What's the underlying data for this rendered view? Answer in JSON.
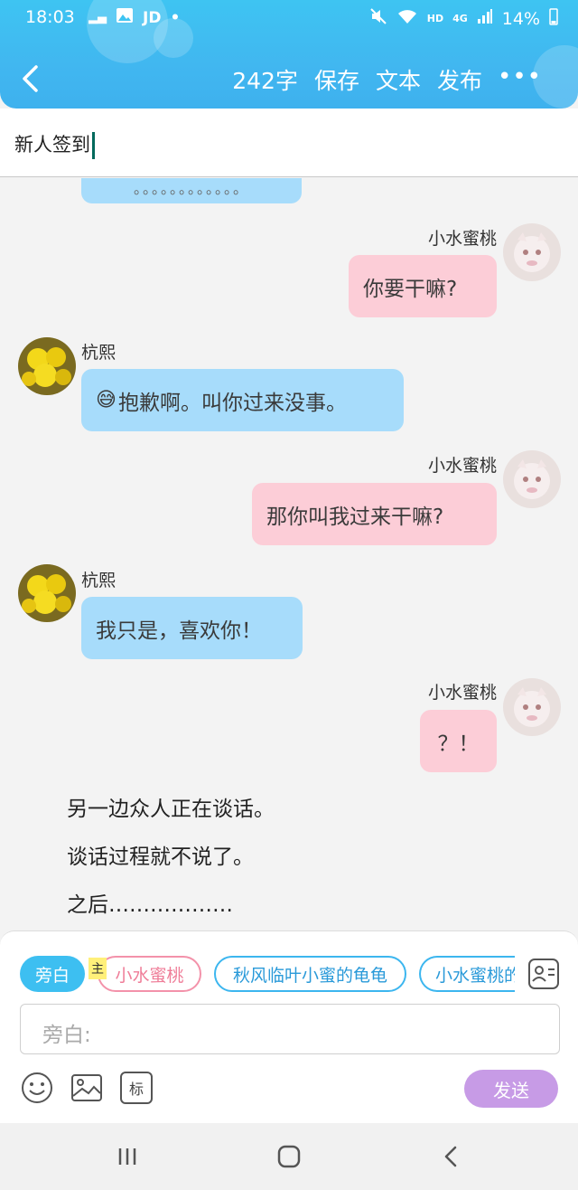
{
  "status_bar": {
    "time": "18:03",
    "app_tag": "JD",
    "dot": "•",
    "hd": "HD",
    "net": "4G",
    "battery": "14%"
  },
  "toolbar": {
    "word_count": "242字",
    "save": "保存",
    "text": "文本",
    "publish": "发布",
    "more": "•••"
  },
  "title": {
    "value": "新人签到"
  },
  "chat": {
    "top_partial_bubble": "。。。。。。。。。。。。",
    "messages": [
      {
        "side": "right",
        "name": "小水蜜桃",
        "text": "你要干嘛?",
        "color": "#fccdd7"
      },
      {
        "side": "left",
        "name": "杭熙",
        "emoji": "😅",
        "text": "抱歉啊。叫你过来没事。",
        "color": "#a7dcfb"
      },
      {
        "side": "right",
        "name": "小水蜜桃",
        "text": "那你叫我过来干嘛?",
        "color": "#fccdd7"
      },
      {
        "side": "left",
        "name": "杭熙",
        "text": "我只是，喜欢你！",
        "color": "#a7dcfb"
      },
      {
        "side": "right",
        "name": "小水蜜桃",
        "text": "？！",
        "color": "#fccdd7"
      }
    ],
    "narration": [
      "另一边众人正在谈话。",
      "谈话过程就不说了。",
      "之后………………"
    ]
  },
  "composer": {
    "roles": [
      "旁白",
      "小水蜜桃",
      "秋风临叶小蜜的龟龟",
      "小水蜜桃的"
    ],
    "main_badge": "主",
    "placeholder": "旁白:",
    "mark_label": "标",
    "send": "发送"
  },
  "colors": {
    "header": "#3ec4f2",
    "accent": "#3dbff1",
    "send": "#c79be6"
  }
}
